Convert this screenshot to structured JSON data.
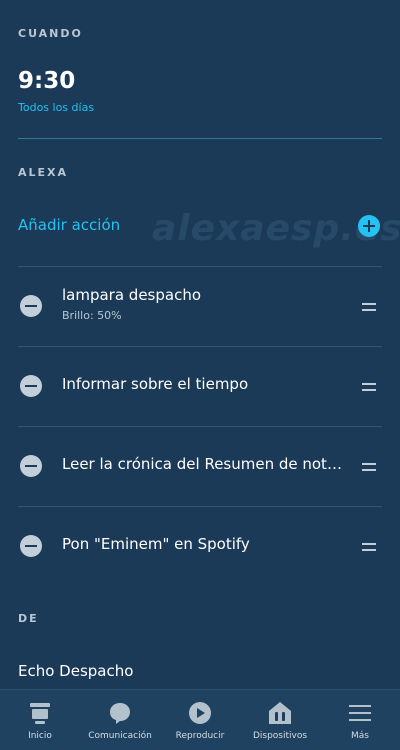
{
  "when": {
    "label": "CUANDO",
    "time": "9:30",
    "recurrence": "Todos los días"
  },
  "alexa": {
    "label": "ALEXA",
    "add_action": "Añadir acción",
    "watermark": "alexaesp.es",
    "actions": [
      {
        "title": "lampara despacho",
        "subtitle": "Brillo: 50%"
      },
      {
        "title": "Informar sobre el tiempo"
      },
      {
        "title": "Leer la crónica del Resumen de noticias"
      },
      {
        "title": "Pon \"Eminem\" en Spotify"
      }
    ]
  },
  "from": {
    "label": "DE",
    "device": "Echo Despacho"
  },
  "nav": [
    {
      "label": "Inicio",
      "icon": "home-icon"
    },
    {
      "label": "Comunicación",
      "icon": "chat-bubble-icon"
    },
    {
      "label": "Reproducir",
      "icon": "play-icon"
    },
    {
      "label": "Dispositivos",
      "icon": "devices-icon"
    },
    {
      "label": "Más",
      "icon": "menu-icon"
    }
  ],
  "colors": {
    "background": "#1a3a57",
    "accent": "#23c2f2",
    "nav_background": "#1f4261"
  }
}
